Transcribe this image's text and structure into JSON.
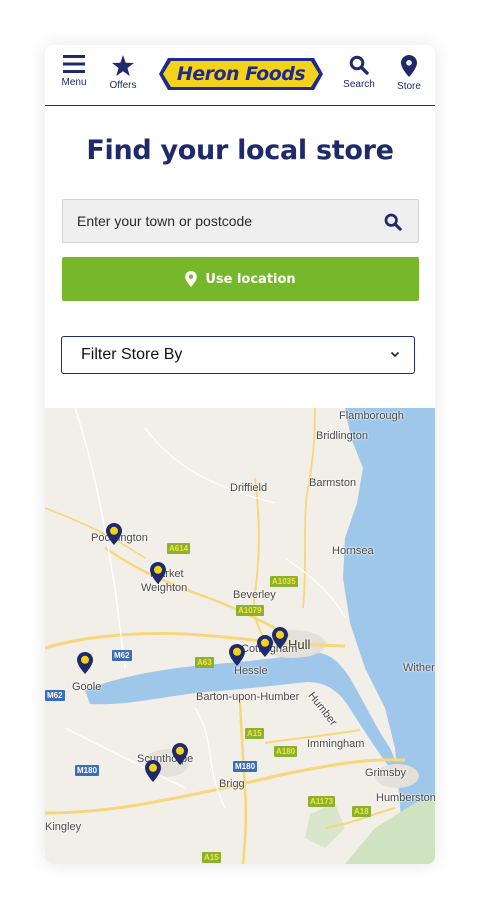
{
  "colors": {
    "navy": "#1f2a6b",
    "green": "#76b82a",
    "logo_yellow": "#f5d31b",
    "map_land": "#f2efe9",
    "map_water": "#9fc7ea",
    "pin": "#1f2a6b",
    "pin_dot": "#f5d31b"
  },
  "header": {
    "menu_label": "Menu",
    "offers_label": "Offers",
    "logo_text": "Heron Foods",
    "search_label": "Search",
    "store_label": "Store"
  },
  "page": {
    "title": "Find your local store"
  },
  "search": {
    "placeholder": "Enter your town or postcode",
    "value": ""
  },
  "location_button": {
    "label": "Use location"
  },
  "filter": {
    "label": "Filter Store By"
  },
  "map": {
    "places": [
      "Flamborough",
      "Bridlington",
      "Driffield",
      "Barmston",
      "Pocklington",
      "Hornsea",
      "Market",
      "Weighton",
      "Beverley",
      "Hull",
      "Cottingham",
      "Hessle",
      "Goole",
      "Barton-upon-Humber",
      "Humber",
      "Withernsea",
      "Immingham",
      "Scunthorpe",
      "Grimsby",
      "Brigg",
      "Humberston",
      "Kingley"
    ],
    "roads": [
      "A614",
      "A1035",
      "A1079",
      "M62",
      "A63",
      "A15",
      "A180",
      "M180",
      "A1173",
      "A18",
      "M62",
      "A15"
    ],
    "store_pins": 9
  }
}
